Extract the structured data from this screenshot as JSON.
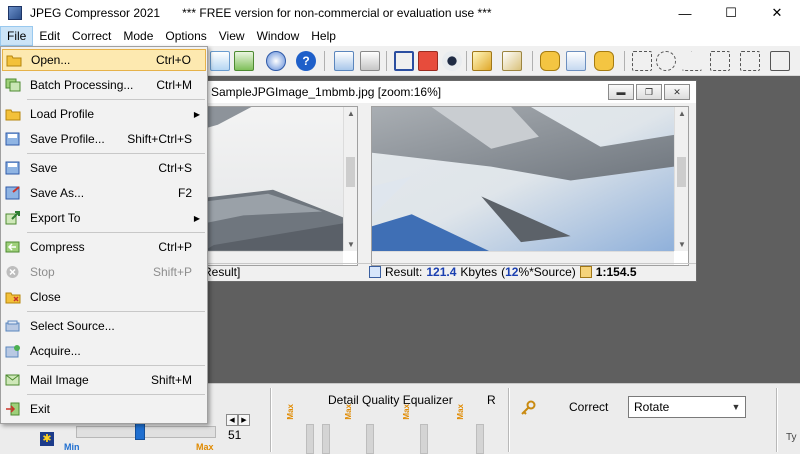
{
  "titlebar": {
    "app_title": "JPEG Compressor 2021",
    "notice": "*** FREE version for non-commercial or evaluation use ***",
    "minimize": "—",
    "maximize": "☐",
    "close": "✕"
  },
  "menubar": {
    "items": [
      "File",
      "Edit",
      "Correct",
      "Mode",
      "Options",
      "View",
      "Window",
      "Help"
    ]
  },
  "file_menu": {
    "items": [
      {
        "label": "Open...",
        "shortcut": "Ctrl+O"
      },
      {
        "label": "Batch Processing...",
        "shortcut": "Ctrl+M"
      },
      {
        "label": "Load Profile",
        "shortcut": ""
      },
      {
        "label": "Save Profile...",
        "shortcut": "Shift+Ctrl+S"
      },
      {
        "label": "Save",
        "shortcut": "Ctrl+S"
      },
      {
        "label": "Save As...",
        "shortcut": "F2"
      },
      {
        "label": "Export To",
        "shortcut": ""
      },
      {
        "label": "Compress",
        "shortcut": "Ctrl+P"
      },
      {
        "label": "Stop",
        "shortcut": "Shift+P"
      },
      {
        "label": "Close",
        "shortcut": ""
      },
      {
        "label": "Select Source...",
        "shortcut": ""
      },
      {
        "label": "Acquire...",
        "shortcut": ""
      },
      {
        "label": "Mail Image",
        "shortcut": "Shift+M"
      },
      {
        "label": "Exit",
        "shortcut": ""
      }
    ],
    "submenu_arrow": "▶"
  },
  "image_window": {
    "title": "SampleJPGImage_1mbmb.jpg  [zoom:16%]",
    "status_left": "Result]",
    "status_result_label": "Result:",
    "status_size": "121.4",
    "status_unit": "Kbytes",
    "status_open_paren": "(",
    "status_percent": "12",
    "status_percent_suffix": "%*Source)",
    "status_ratio": "1:154.5",
    "ctrl_min": "▬",
    "ctrl_restore": "❐",
    "ctrl_close": "✕"
  },
  "bottom_panel": {
    "equalizer_title": "Detail Quality Equalizer",
    "r_label": "R",
    "correct_label": "Correct",
    "correct_value": "Rotate",
    "quality_value": "51",
    "quality_level": 0.46,
    "min_label": "Min",
    "max_label": "Max",
    "spin_left": "◀",
    "spin_right": "▶",
    "combo_arrow": "▼",
    "star": "✱",
    "ty": "Ty"
  },
  "colors": {
    "menu_hover_bg": "#fde9b0",
    "accent_blue": "#1a3fb0",
    "max_orange": "#e08a00",
    "workspace_gray": "#5f5f5f"
  }
}
